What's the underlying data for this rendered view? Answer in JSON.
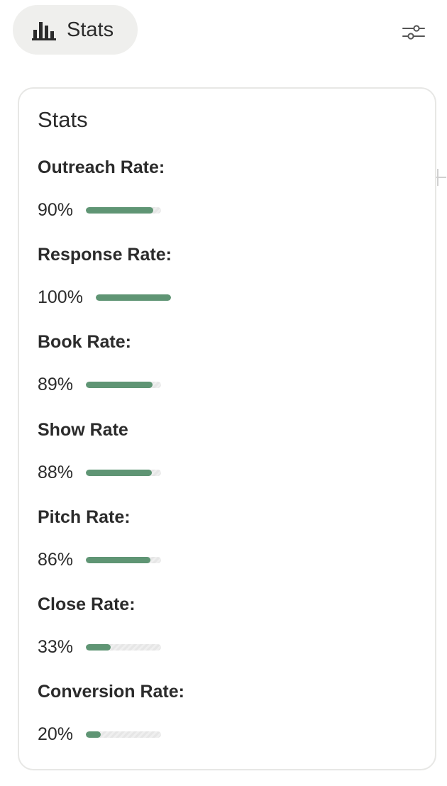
{
  "header": {
    "pill_label": "Stats",
    "pill_icon": "bar-chart-icon",
    "settings_icon": "sliders-icon",
    "plus_icon": "plus-icon"
  },
  "card": {
    "title": "Stats"
  },
  "colors": {
    "bar_fill": "#5f9574",
    "bar_track": "#e6e6e6",
    "pill_bg": "#efefed",
    "card_border": "#e7e7e5"
  },
  "metrics": [
    {
      "label": "Outreach Rate:",
      "value_text": "90%",
      "fraction": 0.9
    },
    {
      "label": "Response Rate:",
      "value_text": "100%",
      "fraction": 1.0
    },
    {
      "label": "Book Rate:",
      "value_text": "89%",
      "fraction": 0.89
    },
    {
      "label": "Show Rate",
      "value_text": "88%",
      "fraction": 0.88
    },
    {
      "label": "Pitch Rate:",
      "value_text": "86%",
      "fraction": 0.86
    },
    {
      "label": "Close Rate:",
      "value_text": "33%",
      "fraction": 0.33
    },
    {
      "label": "Conversion Rate:",
      "value_text": "20%",
      "fraction": 0.2
    }
  ]
}
